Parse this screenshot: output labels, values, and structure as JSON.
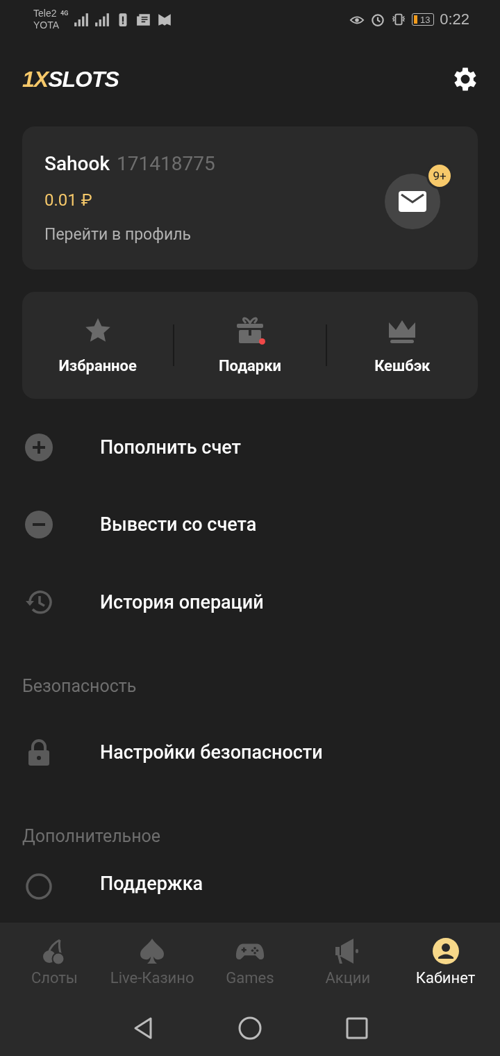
{
  "status_bar": {
    "carrier_1": "Tele2",
    "carrier_2": "YOTA",
    "network": "4G",
    "battery": "13",
    "time": "0:22"
  },
  "header": {
    "logo_accent": "1X",
    "logo_main": "SLOTS"
  },
  "profile": {
    "name": "Sahook",
    "account_id": "171418775",
    "balance": "0.01 ₽",
    "link": "Перейти в профиль",
    "messages_badge": "9+"
  },
  "quick_actions": [
    {
      "kind": "star",
      "label": "Избранное",
      "dot": false
    },
    {
      "kind": "gift",
      "label": "Подарки",
      "dot": true
    },
    {
      "kind": "crown",
      "label": "Кешбэк",
      "dot": false
    }
  ],
  "sections": [
    {
      "items": [
        {
          "kind": "plus",
          "label": "Пополнить счет"
        },
        {
          "kind": "minus",
          "label": "Вывести со счета"
        },
        {
          "kind": "history",
          "label": "История операций"
        }
      ]
    },
    {
      "title": "Безопасность",
      "items": [
        {
          "kind": "lock",
          "label": "Настройки безопасности"
        }
      ]
    },
    {
      "title": "Дополнительное",
      "items": [
        {
          "kind": "support",
          "label": "Поддержка"
        }
      ]
    }
  ],
  "bottom_nav": [
    {
      "kind": "cherry",
      "label": "Слоты",
      "selected": false
    },
    {
      "kind": "spade",
      "label": "Live-Казино",
      "selected": false
    },
    {
      "kind": "gamepad",
      "label": "Games",
      "selected": false
    },
    {
      "kind": "megaphone",
      "label": "Акции",
      "selected": false
    },
    {
      "kind": "user",
      "label": "Кабинет",
      "selected": true
    }
  ]
}
